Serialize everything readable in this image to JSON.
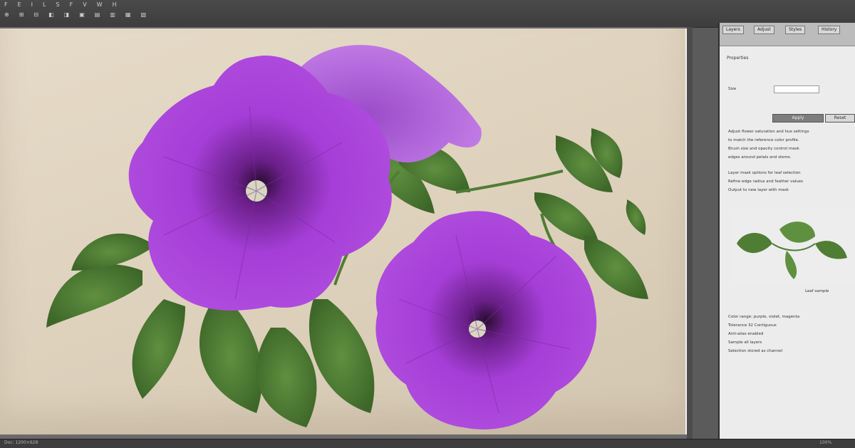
{
  "toolbar": {
    "row1": [
      "F",
      "E",
      "I",
      "L",
      "S",
      "F",
      "V",
      "W",
      "H"
    ],
    "row2": [
      "⊕",
      "⊞",
      "⊟",
      "◧",
      "◨",
      "▣",
      "▤",
      "▥",
      "▦",
      "▧"
    ]
  },
  "document": {
    "image_description": "Purple petunia flowers with green leaves"
  },
  "panel": {
    "tabs": [
      "Layers",
      "Adjust",
      "Styles",
      "History"
    ],
    "header": "Properties",
    "field_label": "Size",
    "field_value": "",
    "apply_label": "Apply",
    "reset_label": "Reset",
    "text_block_1": [
      "Adjust flower saturation and hue settings",
      "to match the reference color profile.",
      "Brush size and opacity control mask",
      "edges around petals and stems."
    ],
    "text_block_2": [
      "Layer mask options for leaf selection",
      "Refine edge radius and feather values",
      "Output to new layer with mask"
    ],
    "thumb_caption": "Leaf sample",
    "text_block_3": [
      "Color range: purple, violet, magenta",
      "Tolerance 32  Contiguous",
      "Anti-alias enabled",
      "Sample all layers",
      "Selection stored as channel"
    ]
  },
  "status": {
    "left": "Doc: 1200×628",
    "right": "100%"
  },
  "colors": {
    "petal": "#a541d9",
    "petal_dark": "#5a1a70",
    "leaf": "#4f7d34",
    "background": "#e2d6c2"
  }
}
